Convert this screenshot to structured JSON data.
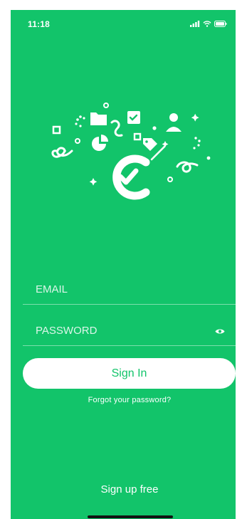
{
  "status_bar": {
    "time": "11:18",
    "icons": [
      "signal-icon",
      "wifi-icon",
      "battery-icon"
    ]
  },
  "illustration": {
    "icon": "checkmark-logo-icon"
  },
  "form": {
    "email_placeholder": "EMAIL",
    "email_value": "",
    "password_placeholder": "PASSWORD",
    "password_value": "",
    "password_toggle_icon": "eye-icon",
    "sign_in_label": "Sign In",
    "forgot_label": "Forgot your password?"
  },
  "footer": {
    "sign_up_label": "Sign up free"
  },
  "colors": {
    "brand_green": "#12c46a",
    "white": "#ffffff"
  }
}
